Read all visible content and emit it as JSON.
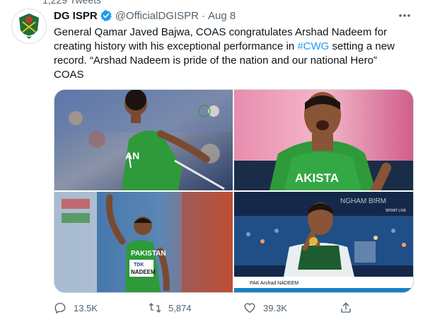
{
  "profile": {
    "name": "DG ISPR",
    "handle": "@OfficialDGISPR",
    "separator": "·",
    "date": "Aug 8",
    "tweets_count_partial": "1,229 Tweets"
  },
  "tweet": {
    "text_before": "General Qamar Javed Bajwa, COAS congratulates Arshad Nadeem for creating history with his exceptional performance in ",
    "hashtag": "#CWG",
    "text_after": " setting a new record. “Arshad Nadeem is pride of the nation and our national Hero” COAS"
  },
  "media": {
    "photos": [
      {
        "icon": "athlete-throwing-photo",
        "jersey_text": "AN"
      },
      {
        "icon": "athlete-celebrating-photo",
        "jersey_text": "AKISTA"
      },
      {
        "icon": "athlete-waving-photo",
        "jersey_text": "PAKISTAN",
        "bib_sponsor": "TDK",
        "bib_name": "NADEEM"
      },
      {
        "icon": "athlete-medal-photo",
        "banner_text": "PAK Arshad NADEEM",
        "background_text": "NGHAM BIRM",
        "logo_text": "SPORT LIVE"
      }
    ]
  },
  "actions": {
    "reply_count": "13.5K",
    "retweet_count": "5,874",
    "like_count": "39.3K"
  },
  "colors": {
    "text": "#0f1419",
    "secondary": "#536471",
    "link": "#1d9bf0",
    "verified": "#1d9bf0",
    "jersey_green": "#2e9a3a"
  }
}
